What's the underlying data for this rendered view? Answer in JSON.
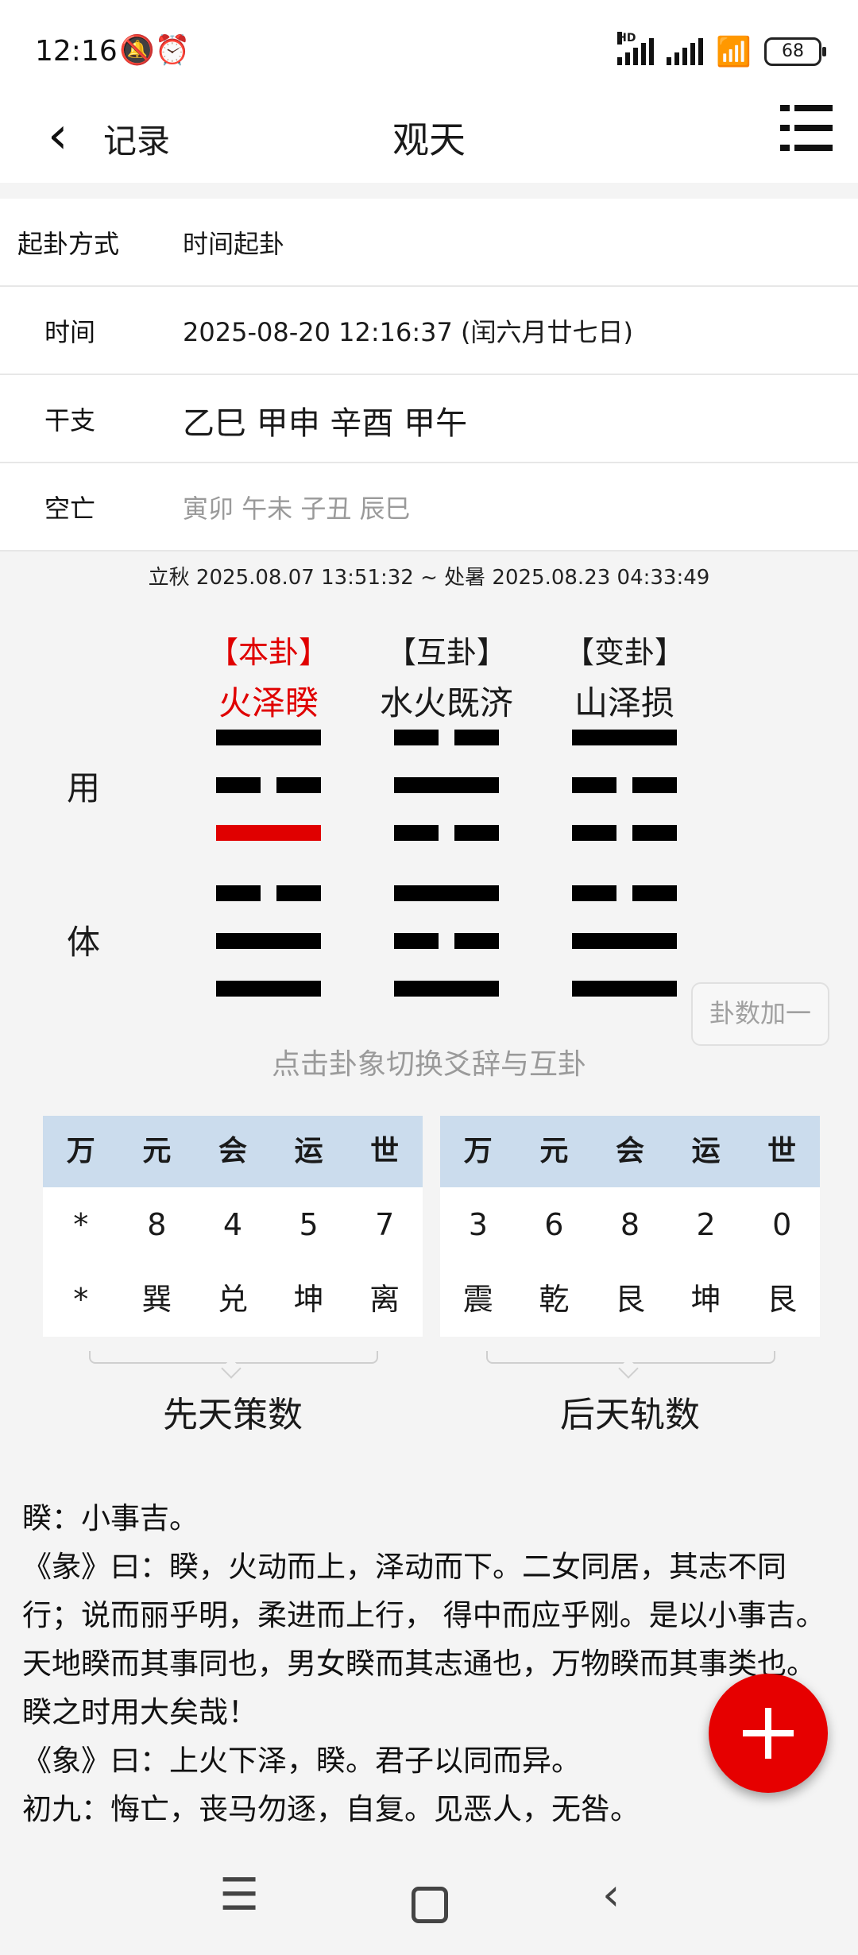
{
  "status": {
    "time": "12:16",
    "battery": "68",
    "hd": "HD"
  },
  "header": {
    "back_label": "记录",
    "title": "观天"
  },
  "info": [
    {
      "key": "起卦方式",
      "value": "时间起卦"
    },
    {
      "key": "时间",
      "value": "2025-08-20 12:16:37 (闰六月廿七日)"
    },
    {
      "key": "干支",
      "value": "乙巳 甲申 辛酉 甲午"
    },
    {
      "key": "空亡",
      "value": "寅卯 午未 子丑 辰巳"
    }
  ],
  "solar_terms": "立秋 2025.08.07 13:51:32 ~ 处暑 2025.08.23 04:33:49",
  "labels": {
    "yong": "用",
    "ti": "体"
  },
  "hexagrams": [
    {
      "tag": "【本卦】",
      "name": "火泽睽",
      "lines_top_to_bottom": [
        1,
        0,
        1,
        0,
        1,
        1
      ],
      "moving_line": 3
    },
    {
      "tag": "【互卦】",
      "name": "水火既济",
      "lines_top_to_bottom": [
        0,
        1,
        0,
        1,
        0,
        1
      ]
    },
    {
      "tag": "【变卦】",
      "name": "山泽损",
      "lines_top_to_bottom": [
        1,
        0,
        0,
        0,
        1,
        1
      ]
    }
  ],
  "add_button": "卦数加一",
  "hint": "点击卦象切换爻辞与互卦",
  "tables": [
    {
      "headers": [
        "万",
        "元",
        "会",
        "运",
        "世"
      ],
      "row1": [
        "*",
        "8",
        "4",
        "5",
        "7"
      ],
      "row2": [
        "*",
        "巽",
        "兑",
        "坤",
        "离"
      ],
      "caption": "先天策数"
    },
    {
      "headers": [
        "万",
        "元",
        "会",
        "运",
        "世"
      ],
      "row1": [
        "3",
        "6",
        "8",
        "2",
        "0"
      ],
      "row2": [
        "震",
        "乾",
        "艮",
        "坤",
        "艮"
      ],
      "caption": "后天轨数"
    }
  ],
  "text_lines": [
    "睽：小事吉。",
    "《彖》曰：睽，火动而上，泽动而下。二女同居，其志不同行；说而丽乎明，柔进而上行， 得中而应乎刚。是以小事吉。天地睽而其事同也，男女睽而其志通也，万物睽而其事类也。睽之时用大矣哉！",
    "《象》曰：上火下泽，睽。君子以同而异。",
    "初九：悔亡，丧马勿逐，自复。见恶人，无咎。"
  ],
  "colors": {
    "accent_red": "#e00000",
    "table_header": "#cbdced",
    "fab": "#e60000"
  }
}
